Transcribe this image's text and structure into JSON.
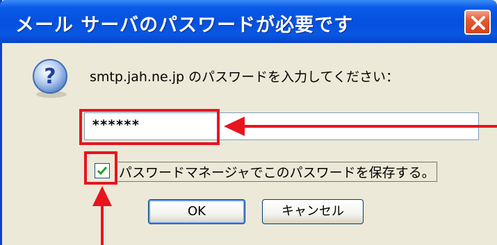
{
  "dialog": {
    "title": "メール サーバのパスワードが必要です",
    "prompt": "smtp.jah.ne.jp のパスワードを入力してください：",
    "password_value": "******",
    "save_password_label": "パスワードマネージャでこのパスワードを保存する。",
    "save_password_checked": true,
    "ok_label": "OK",
    "cancel_label": "キャンセル"
  },
  "icons": [
    "question-icon",
    "close-icon",
    "checkmark-icon"
  ],
  "colors": {
    "titlebar": "#0550df",
    "dialog_bg": "#ece9d8",
    "annotation_red": "#e8141e",
    "close_button": "#e35a32"
  }
}
